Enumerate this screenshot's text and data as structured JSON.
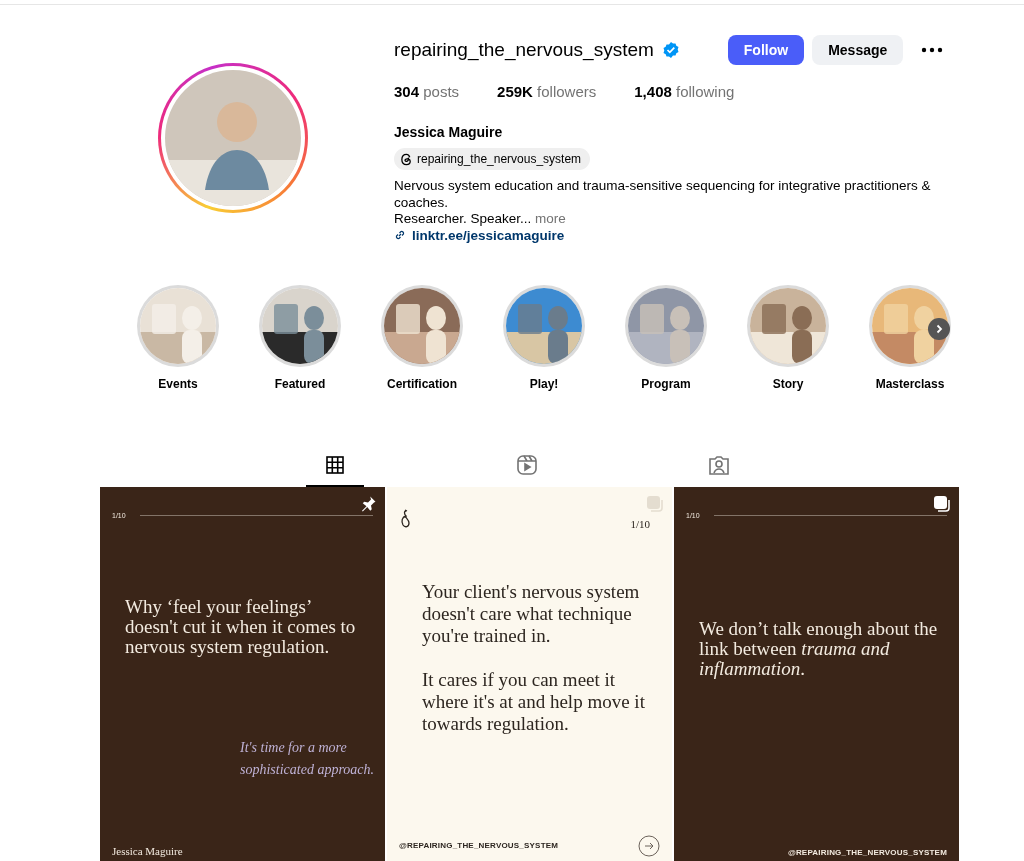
{
  "profile": {
    "username": "repairing_the_nervous_system",
    "verified": true,
    "follow_label": "Follow",
    "message_label": "Message",
    "stats": [
      {
        "value": "304",
        "label": "posts"
      },
      {
        "value": "259K",
        "label": "followers"
      },
      {
        "value": "1,408",
        "label": "following"
      }
    ],
    "name": "Jessica Maguire",
    "threads_handle": "repairing_the_nervous_system",
    "bio": [
      "Nervous system education and trauma-sensitive sequencing for integrative practitioners & coaches.",
      "Researcher. Speaker..."
    ],
    "more_label": "more",
    "link": "linktr.ee/jessicamaguire"
  },
  "highlights": [
    {
      "label": "Events",
      "kind": "picture"
    },
    {
      "label": "Featured",
      "kind": "picture"
    },
    {
      "label": "Certification",
      "kind": "picture"
    },
    {
      "label": "Play!",
      "kind": "picture"
    },
    {
      "label": "Program",
      "kind": "picture"
    },
    {
      "label": "Story",
      "kind": "picture"
    },
    {
      "label": "Masterclass",
      "kind": "picture"
    }
  ],
  "tabs": [
    {
      "kind": "grid",
      "selected": true
    },
    {
      "kind": "reels",
      "selected": false
    },
    {
      "kind": "tagged",
      "selected": false
    }
  ],
  "posts": [
    {
      "kind": "dark",
      "counter": "1/10",
      "pinned": true,
      "carousel": false,
      "headline": "Why ‘feel your feelings’ doesn't cut it when it comes to nervous system regulation.",
      "subline": "It's time for a more sophisticated approach.",
      "footer": "Jessica Maguire"
    },
    {
      "kind": "light",
      "counter": "1/10",
      "pinned": false,
      "carousel": true,
      "paragraphs": [
        "Your client's nervous system doesn't care what technique you're trained in.",
        "It cares if you can meet it where it's at and help move it towards regulation."
      ],
      "footer": "@REPAIRING_THE_NERVOUS_SYSTEM"
    },
    {
      "kind": "dark",
      "counter": "1/10",
      "pinned": false,
      "carousel": true,
      "headline": "We don’t talk enough about the link between *trauma and inflammation*.",
      "footer": "@REPAIRING_THE_NERVOUS_SYSTEM"
    }
  ]
}
